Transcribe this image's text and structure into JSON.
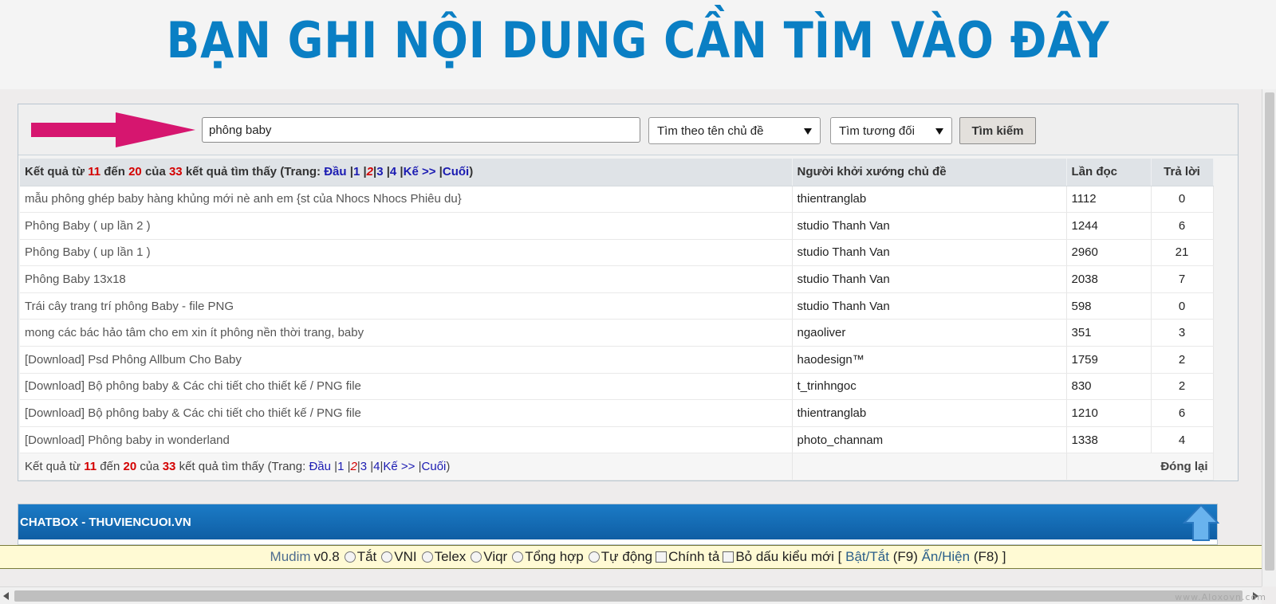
{
  "banner": {
    "title": "BẠN GHI NỘI DUNG CẦN TÌM VÀO ĐÂY"
  },
  "search": {
    "query": "phông baby",
    "field_select": "Tìm theo tên chủ đề",
    "mode_select": "Tìm tương đối",
    "submit_label": "Tìm kiếm"
  },
  "results": {
    "summary_prefix": "Kết quả từ",
    "from": "11",
    "to_word": "đến",
    "to": "20",
    "of_word": "của",
    "total": "33",
    "found_word": "kết quả tìm thấy",
    "pages_open": "(Trang:",
    "first": "Đầu",
    "p1": "1",
    "p2": "2",
    "p3": "3",
    "p4": "4",
    "next": "Kế >>",
    "last": "Cuối",
    "pages_close": ")",
    "columns": [
      "Người khởi xướng chủ đề",
      "Lần đọc",
      "Trả lời"
    ],
    "rows": [
      {
        "topic": "mẫu phông ghép baby hàng khủng mới nè anh em {st của Nhocs Nhocs Phiêu du}",
        "author": "thientranglab",
        "reads": "1112",
        "replies": "0"
      },
      {
        "topic": "Phông Baby ( up lần 2 )",
        "author": "studio Thanh Van",
        "reads": "1244",
        "replies": "6"
      },
      {
        "topic": "Phông Baby ( up lần 1 )",
        "author": "studio Thanh Van",
        "reads": "2960",
        "replies": "21"
      },
      {
        "topic": "Phông Baby 13x18",
        "author": "studio Thanh Van",
        "reads": "2038",
        "replies": "7"
      },
      {
        "topic": "Trái cây trang trí phông Baby - file PNG",
        "author": "studio Thanh Van",
        "reads": "598",
        "replies": "0"
      },
      {
        "topic": "mong các bác hảo tâm cho em xin ít phông nền thời trang, baby",
        "author": "ngaoliver",
        "reads": "351",
        "replies": "3"
      },
      {
        "topic": "[Download] Psd Phông Allbum Cho Baby",
        "author": "haodesign™",
        "reads": "1759",
        "replies": "2"
      },
      {
        "topic": "[Download] Bộ phông baby & Các chi tiết cho thiết kế / PNG file",
        "author": "t_trinhngoc",
        "reads": "830",
        "replies": "2"
      },
      {
        "topic": "[Download] Bộ phông baby & Các chi tiết cho thiết kế / PNG file",
        "author": "thientranglab",
        "reads": "1210",
        "replies": "6"
      },
      {
        "topic": "[Download] Phông baby in wonderland",
        "author": "photo_channam",
        "reads": "1338",
        "replies": "4"
      }
    ],
    "close_label": "Đóng lại"
  },
  "chatbox": {
    "title": "CHATBOX - THUVIENCUOI.VN"
  },
  "mudim": {
    "name": "Mudim",
    "version": "v0.8",
    "opt_off": "Tắt",
    "opt_vni": "VNI",
    "opt_telex": "Telex",
    "opt_viqr": "Viqr",
    "opt_combined": "Tổng hợp",
    "opt_auto": "Tự động",
    "opt_spell": "Chính tả",
    "opt_newstyle": "Bỏ dấu kiểu mới",
    "bracket_open": "[",
    "toggle": "Bật/Tắt",
    "toggle_key": "(F9)",
    "showhide": "Ẩn/Hiện",
    "showhide_key": "(F8)",
    "bracket_close": "]"
  },
  "watermark": "www.Aloxovn.com",
  "colors": {
    "accent": "#0a7fc4",
    "chat_header": "#1570b8",
    "highlight_red": "#d40000",
    "arrow_pink": "#d6166f"
  }
}
